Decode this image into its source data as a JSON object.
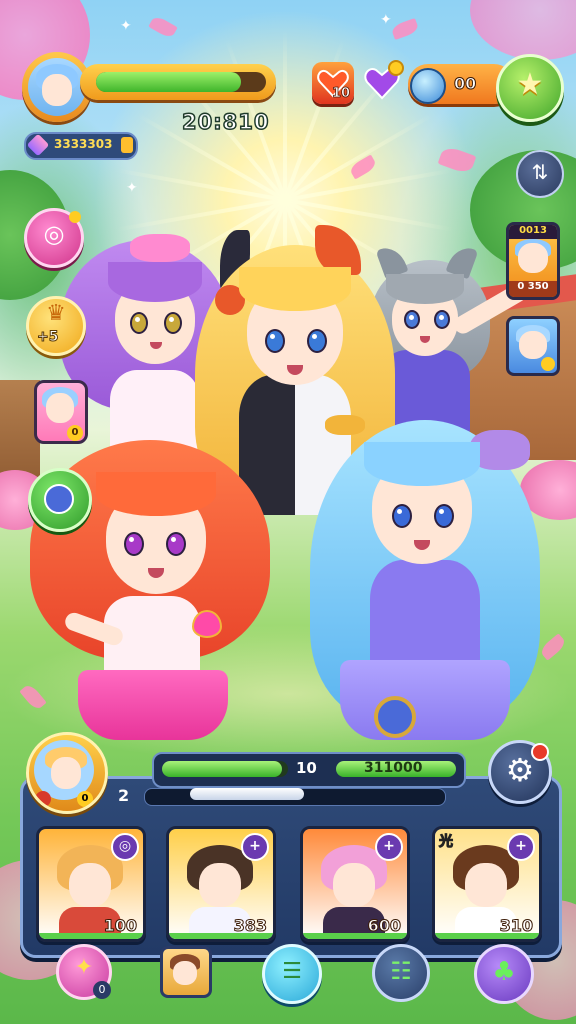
{
  "hud": {
    "player_level_fraction": 0.85,
    "score": "20:810",
    "gems": "3333303",
    "lives": "10",
    "energy": "00"
  },
  "side": {
    "hat_badge": "+5",
    "mini_card_num": "0",
    "right_card_top": "0013",
    "right_card_bottom": "0 350"
  },
  "panel": {
    "bar_a_fraction": 0.95,
    "bar_mid_value": "10",
    "bar_b_value": "311000",
    "level": "2",
    "progress_fraction": 0.38,
    "avatar_badge": "0"
  },
  "cards": [
    {
      "num": "100",
      "badge": "◎",
      "tag": "",
      "bg": "#ffb43a",
      "hair": "#f2b457",
      "body": "#d94a3a"
    },
    {
      "num": "383",
      "badge": "+",
      "tag": "",
      "bg": "#ffcf4a",
      "hair": "#4a3326",
      "body": "#f4f4ff"
    },
    {
      "num": "600",
      "badge": "+",
      "tag": "",
      "bg": "#ff8a3a",
      "hair": "#f2a0d8",
      "body": "#3a2a4a"
    },
    {
      "num": "310",
      "badge": "+",
      "tag": "光",
      "bg": "#ffe18a",
      "hair": "#6a3a1e",
      "body": "#ffffff"
    }
  ],
  "bottom_nav": {
    "hero_count": "0"
  },
  "colors": {
    "accent_green": "#3fb52b",
    "accent_orange": "#f09a1c",
    "panel_blue": "#2f4a78"
  }
}
